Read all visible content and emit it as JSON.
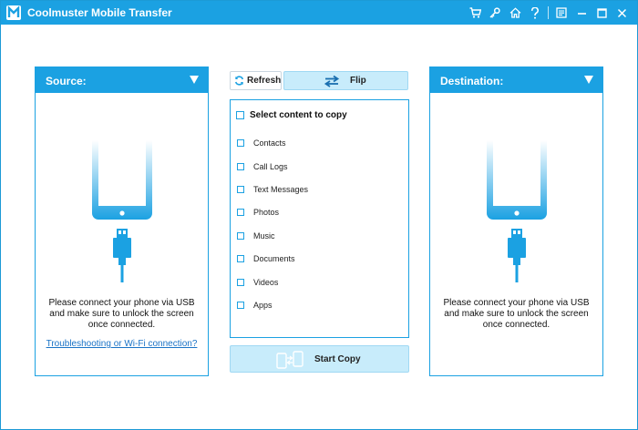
{
  "window": {
    "title": "Coolmuster Mobile Transfer",
    "accent_color": "#1ba1e2",
    "toolbar_icons": [
      "cart-icon",
      "key-icon",
      "home-icon",
      "help-icon",
      "feedback-icon",
      "minimize-icon",
      "maximize-icon",
      "close-icon"
    ]
  },
  "source": {
    "header": "Source:",
    "message": "Please connect your phone via USB and make sure to unlock the screen once connected.",
    "link": "Troubleshooting or Wi-Fi connection?"
  },
  "destination": {
    "header": "Destination:",
    "message": "Please connect your phone via USB and make sure to unlock the screen once connected."
  },
  "actions": {
    "refresh": "Refresh",
    "flip": "Flip",
    "start_copy": "Start Copy"
  },
  "content": {
    "select_all": "Select content to copy",
    "items": [
      {
        "label": "Contacts",
        "checked": false
      },
      {
        "label": "Call Logs",
        "checked": false
      },
      {
        "label": "Text Messages",
        "checked": false
      },
      {
        "label": "Photos",
        "checked": false
      },
      {
        "label": "Music",
        "checked": false
      },
      {
        "label": "Documents",
        "checked": false
      },
      {
        "label": "Videos",
        "checked": false
      },
      {
        "label": "Apps",
        "checked": false
      }
    ]
  }
}
